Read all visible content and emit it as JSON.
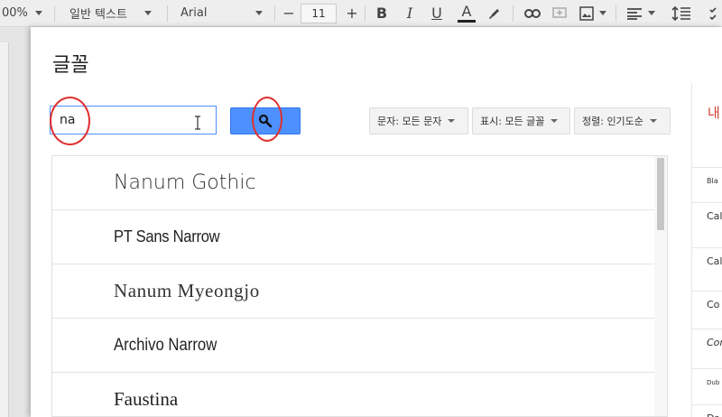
{
  "toolbar": {
    "zoom": "00%",
    "style": "일반 텍스트",
    "font": "Arial",
    "minus": "−",
    "font_size": "11",
    "plus": "+",
    "bold": "B",
    "italic": "I",
    "underline": "U",
    "text_color": "A"
  },
  "dialog": {
    "title": "글꼴",
    "search_value": "na",
    "filters": [
      {
        "label": "문자: 모든 문자"
      },
      {
        "label": "표시: 모든 글꼴"
      },
      {
        "label": "정렬: 인기도순"
      }
    ],
    "fonts": [
      {
        "name": "Nanum Gothic"
      },
      {
        "name": "PT Sans Narrow"
      },
      {
        "name": "Nanum Myeongjo"
      },
      {
        "name": "Archivo Narrow"
      },
      {
        "name": "Faustina"
      }
    ],
    "right_panel": {
      "heading": "내",
      "items": [
        "Bla",
        "Cal",
        "Cal",
        "Co",
        "Cor",
        "Dub",
        "Dr"
      ]
    }
  },
  "colors": {
    "accent_blue": "#4d90fe",
    "annotation_red": "#e03030"
  }
}
